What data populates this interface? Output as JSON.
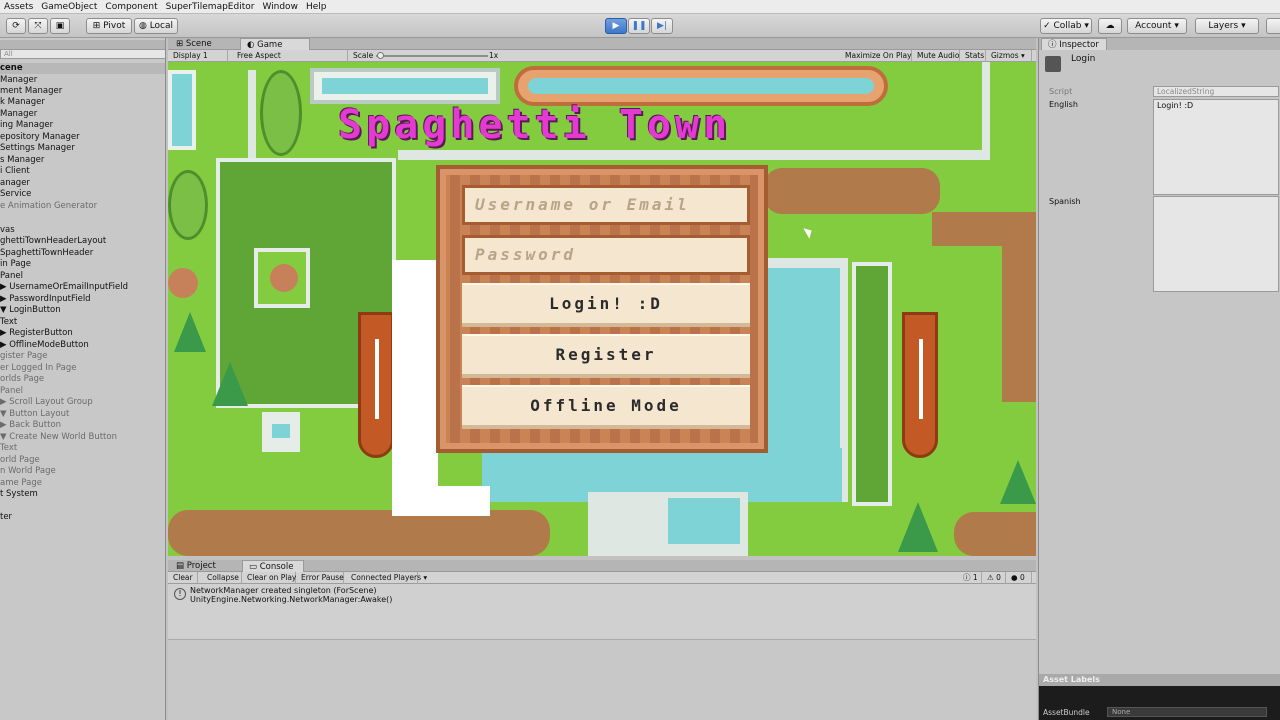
{
  "menu": [
    "Assets",
    "GameObject",
    "Component",
    "SuperTilemapEditor",
    "Window",
    "Help"
  ],
  "toolbar": {
    "pivot": "Pivot",
    "local": "Local",
    "collab": "Collab",
    "account": "Account",
    "layers": "Layers"
  },
  "hierarchy": {
    "search_placeholder": "All",
    "items": [
      {
        "label": "cene",
        "dim": false
      },
      {
        "label": "Manager",
        "dim": false
      },
      {
        "label": "ment Manager",
        "dim": false
      },
      {
        "label": "k Manager",
        "dim": false
      },
      {
        "label": "Manager",
        "dim": false
      },
      {
        "label": "ing Manager",
        "dim": false
      },
      {
        "label": "epository Manager",
        "dim": false
      },
      {
        "label": "Settings Manager",
        "dim": false
      },
      {
        "label": "s Manager",
        "dim": false
      },
      {
        "label": "i Client",
        "dim": false
      },
      {
        "label": "anager",
        "dim": false
      },
      {
        "label": "Service",
        "dim": false
      },
      {
        "label": "e Animation Generator",
        "dim": true
      },
      {
        "label": "",
        "dim": false
      },
      {
        "label": "vas",
        "dim": false
      },
      {
        "label": "ghettiTownHeaderLayout",
        "dim": false
      },
      {
        "label": "SpaghettiTownHeader",
        "dim": false
      },
      {
        "label": "in Page",
        "dim": false
      },
      {
        "label": "Panel",
        "dim": false
      },
      {
        "label": "▶ UsernameOrEmailInputField",
        "dim": false
      },
      {
        "label": "▶ PasswordInputField",
        "dim": false
      },
      {
        "label": "▼ LoginButton",
        "dim": false
      },
      {
        "label": "    Text",
        "dim": false
      },
      {
        "label": "▶ RegisterButton",
        "dim": false
      },
      {
        "label": "▶ OfflineModeButton",
        "dim": false
      },
      {
        "label": "gister Page",
        "dim": true
      },
      {
        "label": "er Logged In Page",
        "dim": true
      },
      {
        "label": "orlds Page",
        "dim": true
      },
      {
        "label": "Panel",
        "dim": true
      },
      {
        "label": "▶ Scroll Layout Group",
        "dim": true
      },
      {
        "label": "▼ Button Layout",
        "dim": true
      },
      {
        "label": "  ▶ Back Button",
        "dim": true
      },
      {
        "label": "  ▼ Create New World Button",
        "dim": true
      },
      {
        "label": "      Text",
        "dim": true
      },
      {
        "label": "orld Page",
        "dim": true
      },
      {
        "label": "n World Page",
        "dim": true
      },
      {
        "label": "ame Page",
        "dim": true
      },
      {
        "label": "t System",
        "dim": false
      },
      {
        "label": "",
        "dim": false
      },
      {
        "label": "ter",
        "dim": false
      }
    ]
  },
  "game_view": {
    "tab_scene": "Scene",
    "tab_game": "Game",
    "display": "Display 1",
    "aspect": "Free Aspect",
    "scale_label": "Scale",
    "scale_value": "1x",
    "maximize": "Maximize On Play",
    "mute": "Mute Audio",
    "stats": "Stats",
    "gizmos": "Gizmos"
  },
  "game": {
    "title": "Spaghetti Town",
    "username_placeholder": "Username or Email",
    "password_placeholder": "Password",
    "login_label": "Login! :D",
    "register_label": "Register",
    "offline_label": "Offline Mode"
  },
  "console": {
    "tab_project": "Project",
    "tab_console": "Console",
    "clear": "Clear",
    "collapse": "Collapse",
    "clear_on_play": "Clear on Play",
    "error_pause": "Error Pause",
    "connected_players": "Connected Players",
    "count_info": "1",
    "count_warn": "0",
    "count_error": "0",
    "message_line1": "NetworkManager created singleton (ForScene)",
    "message_line2": "UnityEngine.Networking.NetworkManager:Awake()"
  },
  "inspector": {
    "tab": "Inspector",
    "object_name": "Login",
    "script_label": "Script",
    "script_value": "LocalizedString",
    "english_label": "English",
    "english_value": "Login! :D",
    "spanish_label": "Spanish",
    "spanish_value": "",
    "asset_labels": "Asset Labels",
    "asset_bundle_label": "AssetBundle",
    "asset_bundle_value": "None"
  },
  "colors": {
    "grass": "#84cc3f",
    "dirt": "#b07a4a",
    "water": "#7ed3d6",
    "title": "#e33ad1",
    "panel": "#c98355",
    "field": "#f4e6cf"
  }
}
